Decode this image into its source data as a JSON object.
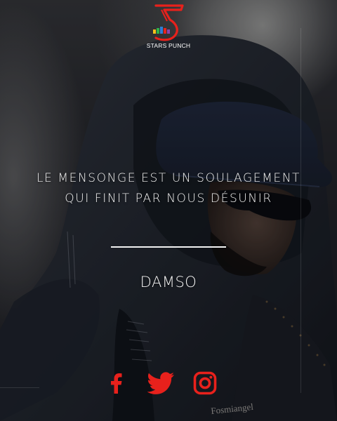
{
  "brand": {
    "name": "STARS PUNCH",
    "accent_color": "#e8211c"
  },
  "quote": {
    "line1": "LE MENSONGE EST UN SOULAGEMENT",
    "line2": "QUI FINIT PAR NOUS DÉSUNIR"
  },
  "author": "DAMSO",
  "background_text": "Fosmiangel",
  "social": [
    {
      "icon": "facebook-icon",
      "color": "#e8211c"
    },
    {
      "icon": "twitter-icon",
      "color": "#e8211c"
    },
    {
      "icon": "instagram-icon",
      "color": "#e8211c"
    }
  ]
}
